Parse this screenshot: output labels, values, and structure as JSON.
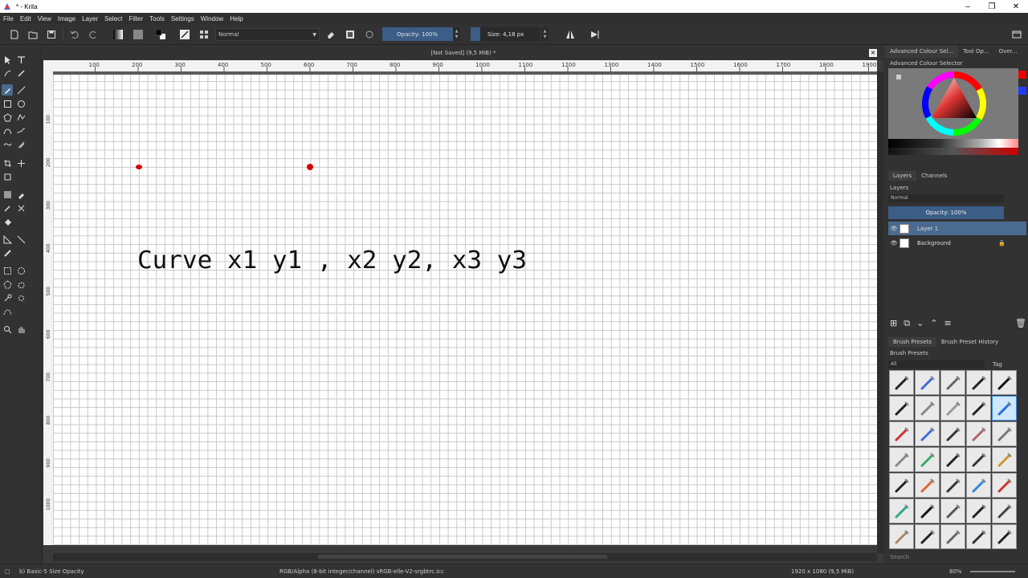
{
  "window": {
    "title": "* - Krita"
  },
  "menu": [
    "File",
    "Edit",
    "View",
    "Image",
    "Layer",
    "Select",
    "Filter",
    "Tools",
    "Settings",
    "Window",
    "Help"
  ],
  "toolbar": {
    "blend_mode": "Normal",
    "opacity_label": "Opacity: 100%",
    "size_label": "Size: 4,18 px"
  },
  "canvas": {
    "tab_title": "[Not Saved]  (9,5 MiB) *",
    "handwriting": "Curve x1 y1 , x2 y2, x3 y3",
    "ruler_top_ticks": [
      "100",
      "200",
      "300",
      "400",
      "500",
      "600",
      "700",
      "800",
      "900",
      "1000",
      "1100",
      "1200",
      "1300",
      "1400",
      "1500",
      "1600",
      "1700",
      "1800",
      "1900"
    ],
    "ruler_left_ticks": [
      "100",
      "200",
      "300",
      "400",
      "500",
      "600",
      "700",
      "800",
      "900",
      "1000"
    ]
  },
  "dock": {
    "tabs": [
      "Advanced Colour Sel...",
      "Tool Op...",
      "Over..."
    ],
    "colour_selector_title": "Advanced Colour Selector",
    "layers_tabs": [
      "Layers",
      "Channels"
    ],
    "layers_title": "Layers",
    "layers_blend": "Normal",
    "layers_opacity": "Opacity:  100%",
    "layers": [
      {
        "name": "Layer 1",
        "selected": true
      },
      {
        "name": "Background",
        "selected": false
      }
    ],
    "brush_tabs": [
      "Brush Presets",
      "Brush Preset History"
    ],
    "brush_title": "Brush Presets",
    "brush_filter": "All",
    "brush_tag": "Tag",
    "search_placeholder": "Search"
  },
  "status": {
    "brush": "b) Basic-5 Size Opacity",
    "color_info": "RGB/Alpha (8-bit integer/channel)  sRGB-elle-V2-srgbtrc.icc",
    "dimensions": "1920 x 1080 (9,5 MiB)",
    "zoom": "80%"
  },
  "colors": {
    "accent": "#3b5d86",
    "selection": "#4b6a8f",
    "dot": "#d40000"
  }
}
